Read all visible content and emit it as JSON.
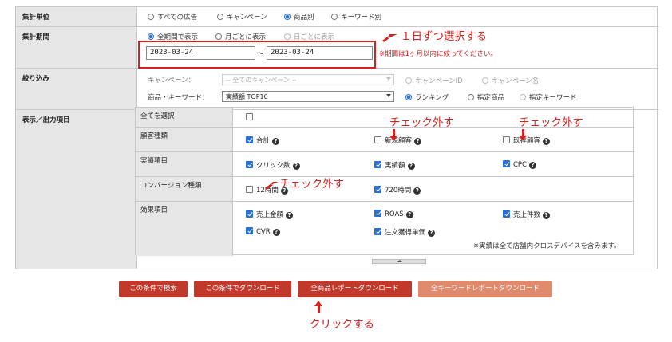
{
  "rows": {
    "unit": {
      "label": "集計単位",
      "options": [
        "すべての広告",
        "キャンペーン",
        "商品別",
        "キーワード別"
      ],
      "selected": "商品別"
    },
    "period": {
      "label": "集計期間",
      "options": [
        "全期間で表示",
        "月ごとに表示",
        "日ごとに表示"
      ],
      "selected": "全期間で表示",
      "start_date": "2023-03-24",
      "end_date": "2023-03-24",
      "separator": "～",
      "limit_note": "※期間は1ヶ月以内に絞ってください。"
    },
    "filter": {
      "label": "絞り込み",
      "campaign_label": "キャンペーン：",
      "campaign_select": "-- 全てのキャンペーン --",
      "campaign_radios": [
        "キャンペーンID",
        "キャンペーン名"
      ],
      "product_label": "商品・キーワード：",
      "product_select": "実績額 TOP10",
      "product_radios": [
        "ランキング",
        "指定商品",
        "指定キーワード"
      ],
      "product_selected": "ランキング"
    },
    "display": {
      "label": "表示／出力項目",
      "select_all": "全てを選択",
      "groups": {
        "customer": {
          "label": "顧客種類",
          "items": [
            {
              "label": "合計",
              "checked": true
            },
            {
              "label": "新規顧客",
              "checked": false
            },
            {
              "label": "既存顧客",
              "checked": false
            }
          ]
        },
        "results": {
          "label": "実績項目",
          "items": [
            {
              "label": "クリック数",
              "checked": true
            },
            {
              "label": "実績額",
              "checked": true
            },
            {
              "label": "CPC",
              "checked": true
            }
          ]
        },
        "conversion": {
          "label": "コンバージョン種類",
          "items": [
            {
              "label": "12時間",
              "checked": false
            },
            {
              "label": "720時間",
              "checked": true
            }
          ]
        },
        "effect": {
          "label": "効果項目",
          "items": [
            {
              "label": "売上金額",
              "checked": true
            },
            {
              "label": "ROAS",
              "checked": true
            },
            {
              "label": "売上件数",
              "checked": true
            },
            {
              "label": "CVR",
              "checked": true
            },
            {
              "label": "注文獲得単価",
              "checked": true
            }
          ]
        }
      },
      "device_note": "※実績は全て店舗内クロスデバイスを含みます。"
    }
  },
  "buttons": {
    "search": "この条件で検索",
    "download": "この条件でダウンロード",
    "product_report": "全商品レポートダウンロード",
    "keyword_report": "全キーワードレポートダウンロード"
  },
  "annotations": {
    "select_daily": "１日ずつ選択する",
    "uncheck": "チェック外す",
    "click": "クリックする"
  },
  "colors": {
    "accent_red": "#d2231e",
    "button_red": "#c0392b",
    "button_light": "#e08a6d",
    "checkbox_blue": "#2a6fd1"
  }
}
